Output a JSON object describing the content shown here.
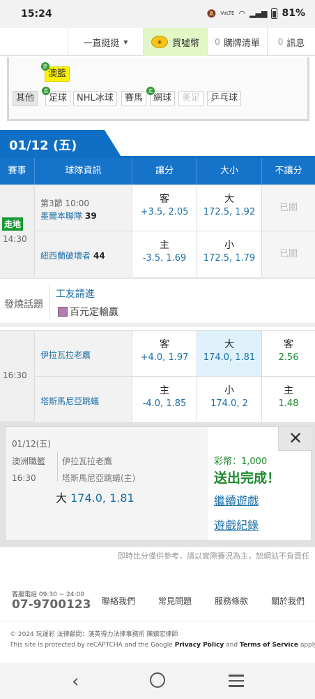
{
  "status_bar": {
    "time": "15:24",
    "icons": [
      "mute-icon",
      "volte-icon",
      "wifi-icon",
      "signal-icon",
      "battery-icon"
    ],
    "volte": "VoLTE",
    "battery": "81%"
  },
  "nav": {
    "user": "一直挺挺",
    "coin": "買噓幣",
    "cart_count": "0",
    "cart": "購牌清單",
    "msg_count": "0",
    "msg": "訊息"
  },
  "sports": {
    "top": [
      {
        "label": "澳籃",
        "live": true,
        "highlight": true
      }
    ],
    "row": [
      {
        "label": "其他",
        "active": true
      },
      {
        "label": "足球",
        "live": true
      },
      {
        "label": "NHL冰球"
      },
      {
        "label": "賽馬"
      },
      {
        "label": "網球",
        "live": true
      },
      {
        "label": "美足",
        "disabled": true
      },
      {
        "label": "乒乓球"
      }
    ],
    "live_mark": "走"
  },
  "date_tab": "01/12 (五)",
  "table_header": [
    "賽事",
    "球隊資訊",
    "讓分",
    "大小",
    "不讓分"
  ],
  "game1": {
    "live_badge": "走地",
    "time": "14:30",
    "quarter": "第3節 10:00",
    "away_team": "墨爾本聯隊",
    "away_score": "39",
    "home_team": "紐西蘭破壞者",
    "home_score": "44",
    "spread": [
      {
        "side": "客",
        "odds": "+3.5, 2.05"
      },
      {
        "side": "主",
        "odds": "-3.5, 1.69"
      }
    ],
    "total": [
      {
        "side": "大",
        "odds": "172.5, 1.92"
      },
      {
        "side": "小",
        "odds": "172.5, 1.79"
      }
    ],
    "moneyline": [
      "已關",
      "已關"
    ]
  },
  "hot_topic": {
    "label": "發燒話題",
    "link1": "工友請進",
    "link2": "百元定輸贏"
  },
  "game2": {
    "time": "16:30",
    "away_team": "伊拉瓦拉老鷹",
    "home_team": "塔斯馬尼亞跳蟻",
    "spread": [
      {
        "side": "客",
        "odds": "+4.0, 1.97"
      },
      {
        "side": "主",
        "odds": "-4.0, 1.85"
      }
    ],
    "total": [
      {
        "side": "大",
        "odds": "174.0, 1.81"
      },
      {
        "side": "小",
        "odds": "174.0, 2"
      }
    ],
    "moneyline": [
      {
        "side": "客",
        "odds": "2.56"
      },
      {
        "side": "主",
        "odds": "1.48"
      }
    ]
  },
  "bet_confirm": {
    "date": "01/12(五)",
    "league": "澳洲職籃",
    "time": "16:30",
    "team1": "伊拉瓦拉老鷹",
    "team2": "塔斯馬尼亞跳蟻(主)",
    "pick": "大",
    "pick_odds": "174.0, 1.81",
    "coins": "彩幣：1,000",
    "done": "送出完成！",
    "continue": "繼續遊戲",
    "record": "遊戲紀錄"
  },
  "disclaimer": "即時比分僅供參考，請以實際賽況為主，恕網站不負責任",
  "footer": {
    "cs_label": "客服電話 09:30 ~ 24:00",
    "cs_phone": "07-9700123",
    "links": [
      "聯絡我們",
      "常見問題",
      "服務條款",
      "關於我們"
    ],
    "copyright": "© 2024 玩運彩 法律顧問：漢英得力法律事務所 陳鎮宏律師",
    "recaptcha_pre": "This site is protected by reCAPTCHA and the Google",
    "privacy": "Privacy Policy",
    "and": "and",
    "terms": "Terms of Service",
    "apply": "apply."
  },
  "colors": {
    "primary_blue": "#1573c9",
    "live_green": "#179a35",
    "link_blue": "#1a6fa8",
    "success_green": "#1d8a2e"
  }
}
